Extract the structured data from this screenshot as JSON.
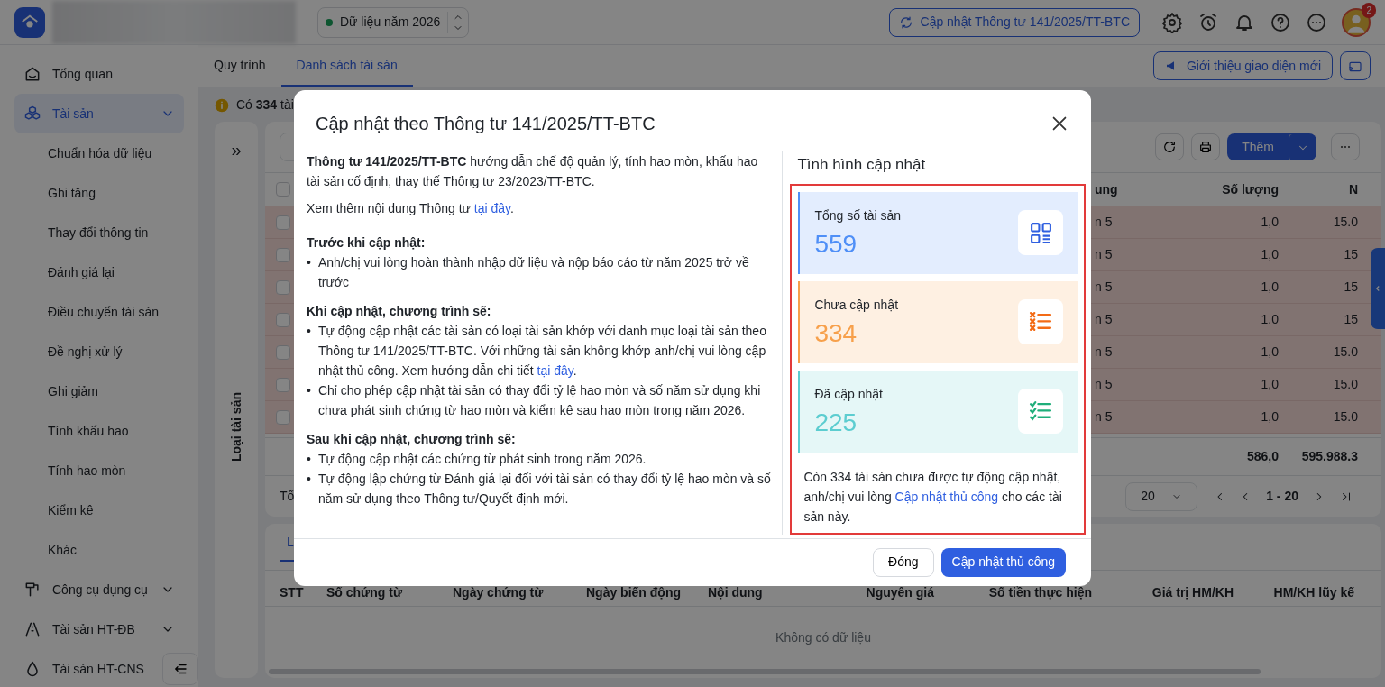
{
  "header": {
    "year_selector": "Dữ liệu năm 2026",
    "update_button": "Cập nhật Thông tư 141/2025/TT-BTC",
    "notification_count": "2"
  },
  "sidebar": {
    "items": [
      {
        "label": "Tổng quan",
        "selected": false
      },
      {
        "label": "Tài sản",
        "selected": true,
        "expandable": true,
        "children": [
          {
            "label": "Chuẩn hóa dữ liệu",
            "selected": false
          },
          {
            "label": "Ghi tăng",
            "selected": false
          },
          {
            "label": "Thay đổi thông tin",
            "selected": false
          },
          {
            "label": "Đánh giá lại",
            "selected": false
          },
          {
            "label": "Điều chuyển tài sản",
            "selected": false
          },
          {
            "label": "Đề nghị xử lý",
            "selected": false
          },
          {
            "label": "Ghi giảm",
            "selected": false
          },
          {
            "label": "Tính khấu hao",
            "selected": false
          },
          {
            "label": "Tính hao mòn",
            "selected": false
          },
          {
            "label": "Kiểm kê",
            "selected": false
          },
          {
            "label": "Khác",
            "selected": false
          }
        ]
      },
      {
        "label": "Công cụ dụng cụ",
        "selected": false,
        "expandable": true
      },
      {
        "label": "Tài sản HT-ĐB",
        "selected": false,
        "expandable": true
      },
      {
        "label": "Tài sản HT-CNS",
        "selected": false
      }
    ]
  },
  "tabs": [
    {
      "label": "Quy trình",
      "selected": false
    },
    {
      "label": "Danh sách tài sản",
      "selected": true
    }
  ],
  "intro_button": "Giới thiệu giao diện mới",
  "notice": "Có **334** tài",
  "side_panel": {
    "expand": "»",
    "label": "Loại tài sản"
  },
  "table": {
    "add_button": "Thêm",
    "all_checked": false,
    "columns": [
      "ung",
      "Số lượng",
      "N"
    ],
    "rows": [
      {
        "checked": false,
        "cells": [
          "n 5",
          "1,0",
          "15.0"
        ]
      },
      {
        "checked": false,
        "cells": [
          "n 5",
          "1,0",
          "15"
        ]
      },
      {
        "checked": false,
        "cells": [
          "n 5",
          "1,0",
          "15"
        ]
      },
      {
        "checked": false,
        "cells": [
          "n 5",
          "1,0",
          "15"
        ]
      },
      {
        "checked": false,
        "cells": [
          "n 5",
          "1,0",
          "15.0"
        ]
      },
      {
        "checked": false,
        "cells": [
          "n 5",
          "1,0",
          "15.0"
        ]
      },
      {
        "checked": false,
        "cells": [
          "n 5",
          "1,0",
          "15.0"
        ]
      }
    ],
    "totals": [
      "586,0",
      "595.988.3"
    ],
    "footer_label": "Tổ",
    "page_size": "20",
    "page_range": "1 - 20"
  },
  "detail": {
    "tabs": [
      {
        "label": "L",
        "selected": true
      }
    ],
    "columns": [
      "STT",
      "Số chứng từ",
      "Ngày chứng từ",
      "Ngày biến động",
      "Nội dung",
      "Nguyên giá",
      "Số tiền thực hiện",
      "Giá trị HM/KH",
      "HM/KH lũy kế"
    ],
    "empty_text": "Không có dữ liệu"
  },
  "modal": {
    "title": "Cập nhật theo Thông tư 141/2025/TT-BTC",
    "intro": "**Thông tư 141/2025/TT-BTC** hướng dẫn chế độ quản lý, tính hao mòn, khấu hao tài sản cố định, thay thế Thông tư 23/2023/TT-BTC.",
    "more": {
      "text": "Xem thêm nội dung Thông tư ",
      "link": "tại đây",
      "after": "."
    },
    "sections": [
      {
        "heading": "Trước khi cập nhật:",
        "marker": "•",
        "bullets": [
          {
            "text": "Anh/chị vui lòng hoàn thành nhập dữ liệu và nộp báo cáo từ năm 2025 trở về trước"
          }
        ]
      },
      {
        "heading": "Khi cập nhật, chương trình sẽ:",
        "marker": "•",
        "bullets": [
          {
            "text": "Tự động cập nhật các tài sản có loại tài sản khớp với danh mục loại tài sản theo Thông tư 141/2025/TT-BTC. Với những tài sản không khớp anh/chị vui lòng cập nhật thủ công. Xem hướng dẫn chi tiết ",
            "link": "tại đây",
            "after": "."
          },
          {
            "text": "Chỉ cho phép cập nhật tài sản có thay đổi tỷ lệ hao mòn và số năm sử dụng khi chưa phát sinh chứng từ hao mòn và kiểm kê sau hao mòn trong năm 2026."
          }
        ]
      },
      {
        "heading": "Sau khi cập nhật, chương trình sẽ:",
        "marker": "•",
        "bullets": [
          {
            "text": "Tự động cập nhật các chứng từ phát sinh trong năm 2026."
          },
          {
            "text": "Tự động lập chứng từ Đánh giá lại đối với tài sản có thay đổi tỷ lệ hao mòn và số năm sử dụng theo Thông tư/Quyết định mới."
          }
        ]
      }
    ],
    "status": {
      "title": "Tình hình cập nhật",
      "stats": [
        {
          "label": "Tổng số tài sản",
          "value": "559",
          "color": "#4f8ff7",
          "kind": "grid"
        },
        {
          "label": "Chưa cập nhật",
          "value": "334",
          "color": "#f7a04b",
          "kind": "crosses"
        },
        {
          "label": "Đã cập nhật",
          "value": "225",
          "color": "#5ccdd0",
          "kind": "checks"
        }
      ],
      "note": {
        "text": "Còn 334 tài sản chưa được tự động cập nhật, anh/chị vui lòng ",
        "link": "Cập nhật thủ công",
        "after": " cho các tài sản này."
      }
    },
    "buttons": [
      {
        "label": "Đóng",
        "kind": "secondary"
      },
      {
        "label": "Cập nhật thủ công",
        "kind": "primary"
      }
    ]
  }
}
